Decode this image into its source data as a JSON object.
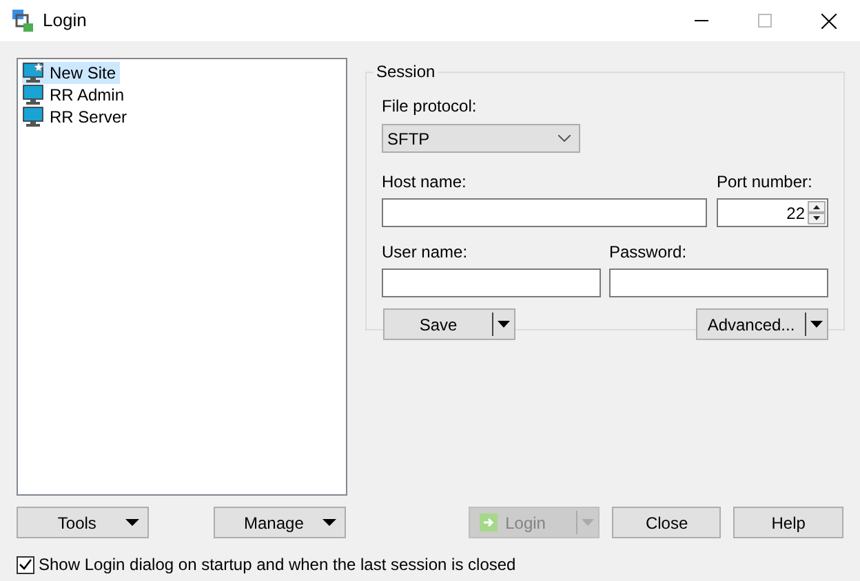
{
  "window": {
    "title": "Login"
  },
  "sites": [
    {
      "label": "New Site",
      "kind": "new",
      "selected": true
    },
    {
      "label": "RR Admin",
      "kind": "saved",
      "selected": false
    },
    {
      "label": "RR Server",
      "kind": "saved",
      "selected": false
    }
  ],
  "session": {
    "title": "Session",
    "file_protocol": {
      "label": "File protocol:",
      "value": "SFTP"
    },
    "host_name": {
      "label": "Host name:"
    },
    "port_number": {
      "label": "Port number:",
      "value": "22"
    },
    "user_name": {
      "label": "User name:"
    },
    "password": {
      "label": "Password:"
    },
    "save_button": {
      "label": "Save"
    },
    "advanced_button": {
      "label": "Advanced..."
    }
  },
  "tools_button": {
    "label": "Tools"
  },
  "manage_button": {
    "label": "Manage"
  },
  "login_button": {
    "label": "Login",
    "disabled": true
  },
  "close_button": {
    "label": "Close"
  },
  "help_button": {
    "label": "Help"
  },
  "show_on_startup": {
    "label": "Show Login dialog on startup and when the last session is closed",
    "checked": true
  }
}
